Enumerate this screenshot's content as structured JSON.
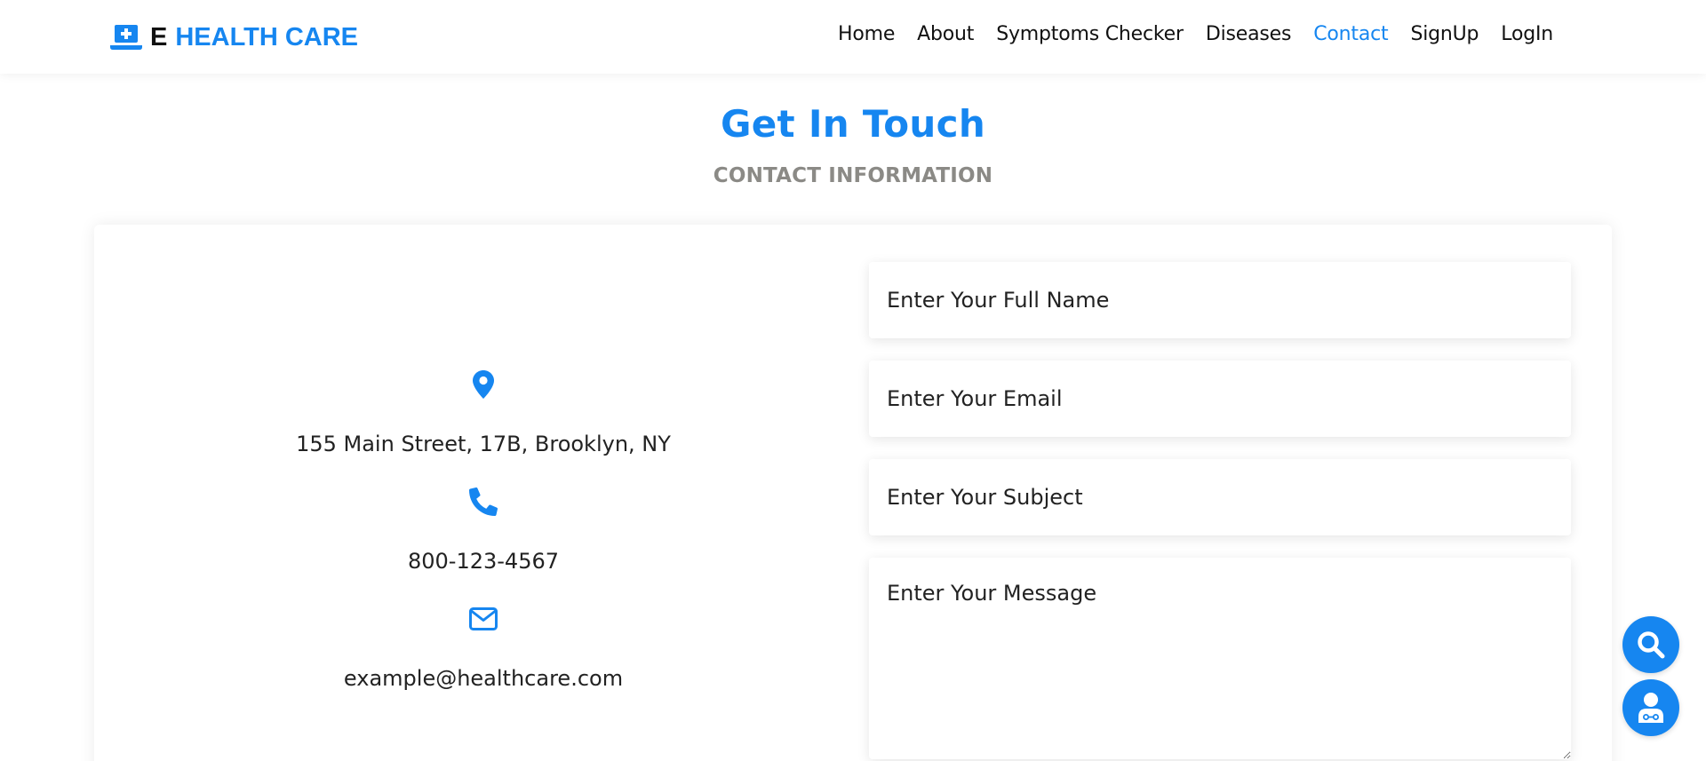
{
  "brand": {
    "prefix": "E",
    "name": "HEALTH CARE",
    "icon": "laptop-medical-icon"
  },
  "nav": {
    "items": [
      {
        "label": "Home"
      },
      {
        "label": "About"
      },
      {
        "label": "Symptoms Checker"
      },
      {
        "label": "Diseases"
      },
      {
        "label": "Contact",
        "active": true
      },
      {
        "label": "SignUp"
      },
      {
        "label": "LogIn"
      }
    ]
  },
  "page": {
    "title": "Get In Touch",
    "subtitle": "CONTACT INFORMATION"
  },
  "contact_info": {
    "address": {
      "icon": "map-pin-icon",
      "text": "155 Main Street, 17B, Brooklyn, NY"
    },
    "phone": {
      "icon": "phone-icon",
      "text": "800-123-4567"
    },
    "email": {
      "icon": "envelope-icon",
      "text": "example@healthcare.com"
    }
  },
  "form": {
    "name_placeholder": "Enter Your Full Name",
    "email_placeholder": "Enter Your Email",
    "subject_placeholder": "Enter Your Subject",
    "message_placeholder": "Enter Your Message"
  },
  "floating_buttons": [
    {
      "icon": "search-icon"
    },
    {
      "icon": "doctor-icon"
    }
  ],
  "colors": {
    "accent": "#1686f0",
    "subtitle": "#8b8a86",
    "text": "#222222"
  }
}
